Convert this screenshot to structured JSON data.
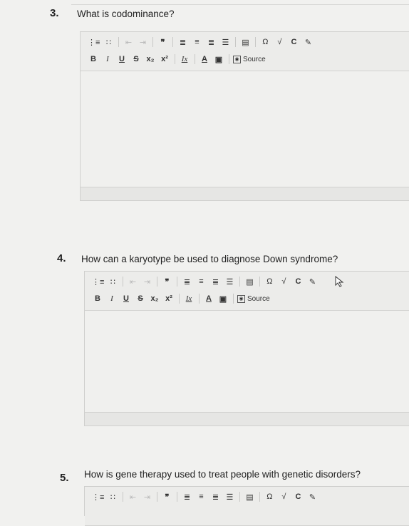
{
  "questions": [
    {
      "number": "3.",
      "text": "What is codominance?"
    },
    {
      "number": "4.",
      "text": "How can a karyotype be used to diagnose Down syndrome?"
    },
    {
      "number": "5.",
      "text": "How is gene therapy used to treat people with genetic disorders?"
    }
  ],
  "toolbar": {
    "row1": [
      "numbered-list",
      "bulleted-list",
      "decrease-indent",
      "increase-indent",
      "blockquote",
      "align-left",
      "align-center",
      "align-right",
      "justify",
      "horizontal-rule",
      "special-char",
      "sqrt",
      "undo",
      "edit"
    ],
    "bold": "B",
    "italic": "I",
    "underline": "U",
    "strike": "S",
    "subscript": "x₂",
    "superscript": "x²",
    "clear_format": "Ix",
    "text_color": "A",
    "bg_color": "▣",
    "source": "Source"
  }
}
